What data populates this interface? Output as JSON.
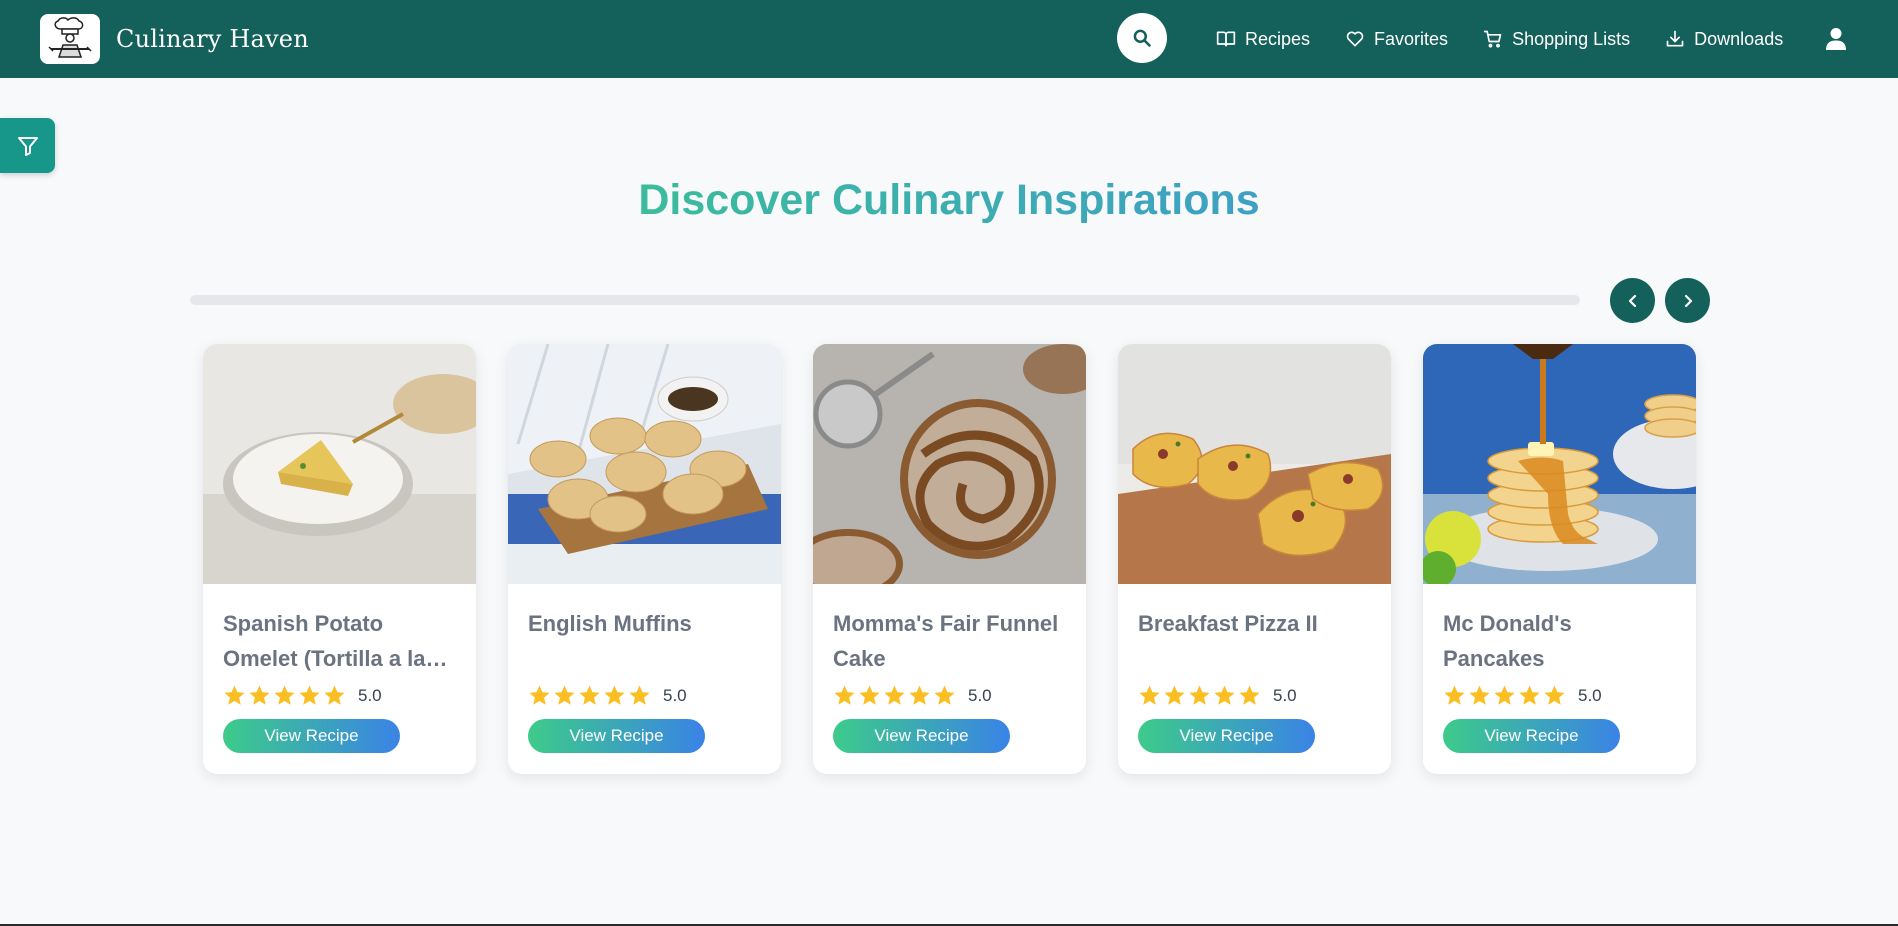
{
  "brand": {
    "name": "Culinary Haven",
    "logo_icon": "chef-logo"
  },
  "nav": {
    "search_icon": "search-icon",
    "links": [
      {
        "label": "Recipes",
        "icon": "book-icon"
      },
      {
        "label": "Favorites",
        "icon": "heart-icon"
      },
      {
        "label": "Shopping Lists",
        "icon": "cart-icon"
      },
      {
        "label": "Downloads",
        "icon": "download-icon"
      }
    ],
    "user_icon": "user-icon"
  },
  "filter_icon": "filter-icon",
  "page": {
    "title": "Discover Culinary Inspirations"
  },
  "carousel": {
    "prev_icon": "chevron-left-icon",
    "next_icon": "chevron-right-icon",
    "cards": [
      {
        "title": "Spanish Potato Omelet (Tortilla a la Española)",
        "rating": "5.0",
        "stars": 5,
        "button": "View Recipe"
      },
      {
        "title": "English Muffins",
        "rating": "5.0",
        "stars": 5,
        "button": "View Recipe"
      },
      {
        "title": "Momma's Fair Funnel Cake",
        "rating": "5.0",
        "stars": 5,
        "button": "View Recipe"
      },
      {
        "title": "Breakfast Pizza II",
        "rating": "5.0",
        "stars": 5,
        "button": "View Recipe"
      },
      {
        "title": "Mc Donald's Pancakes",
        "rating": "5.0",
        "stars": 5,
        "button": "View Recipe"
      }
    ]
  },
  "colors": {
    "nav_bg": "#14605a",
    "accent": "#17968a",
    "star": "#fbbf24",
    "title_gradient_start": "#3cbc9c",
    "title_gradient_end": "#3ea0c4",
    "button_gradient_start": "#3dcb8a",
    "button_gradient_end": "#3a83e6"
  }
}
